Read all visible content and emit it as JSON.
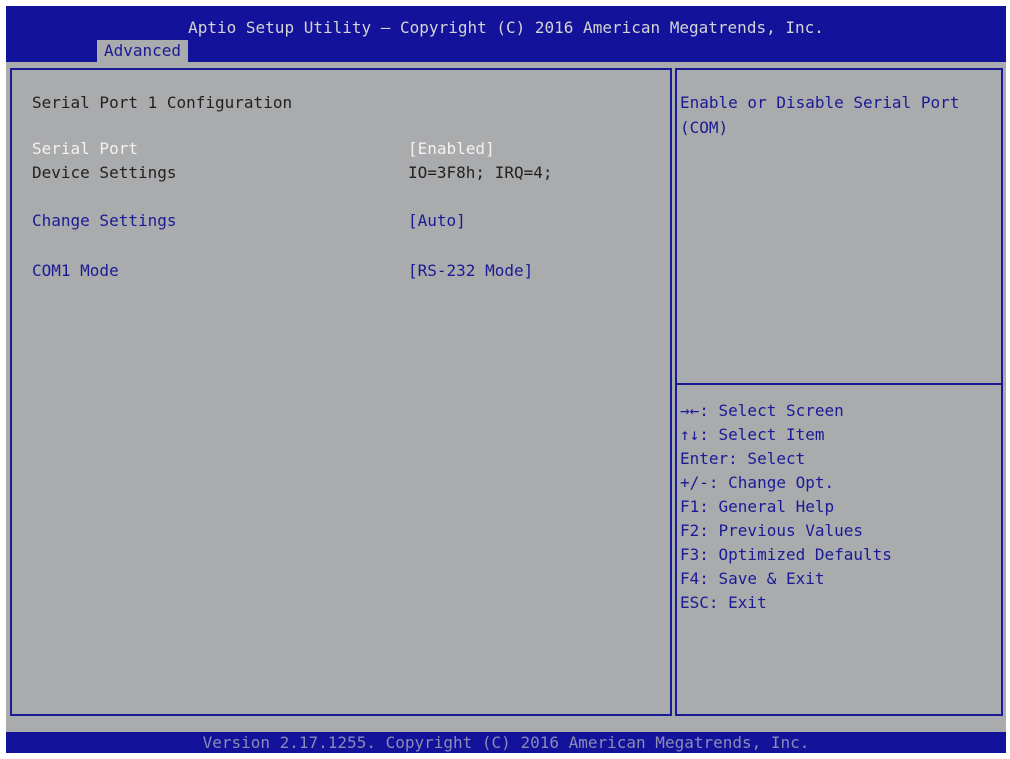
{
  "header": {
    "title": "Aptio Setup Utility – Copyright (C) 2016 American Megatrends, Inc.",
    "active_tab": "Advanced"
  },
  "main": {
    "section_title": "Serial Port 1 Configuration",
    "settings": [
      {
        "label": "Serial Port",
        "value": "[Enabled]"
      },
      {
        "label": "Device Settings",
        "value": "IO=3F8h; IRQ=4;"
      },
      {
        "label": "Change Settings",
        "value": "[Auto]"
      },
      {
        "label": "COM1 Mode",
        "value": "[RS-232 Mode]"
      }
    ]
  },
  "help": {
    "description": "Enable or Disable Serial Port (COM)",
    "keys": [
      "→←: Select Screen",
      "↑↓: Select Item",
      "Enter: Select",
      "+/-: Change Opt.",
      "F1: General Help",
      "F2: Previous Values",
      "F3: Optimized Defaults",
      "F4: Save & Exit",
      "ESC: Exit"
    ]
  },
  "footer": {
    "version": "Version 2.17.1255. Copyright (C) 2016 American Megatrends, Inc."
  },
  "colors": {
    "bios_blue": "#13129a",
    "panel_gray": "#aaabad",
    "highlight_text": "#f2f2f2",
    "selectable_text": "#1b1a96",
    "static_text": "#222222"
  }
}
